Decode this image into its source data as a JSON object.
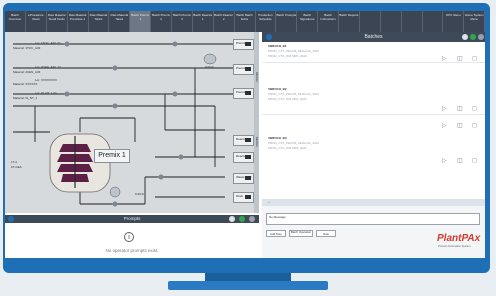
{
  "nav": {
    "buttons": [
      "Batch Overview",
      "eProcedure Views",
      "Raw Material Small Tanks",
      "Raw Material Premixes 1",
      "Raw Material Tanks",
      "Raw Material Tanks",
      "Batch Premix 1",
      "Batch Premix 2",
      "Batch Premix 3",
      "Batch Reactor 1",
      "Batch Reactor 2",
      "Batch Batch Extra",
      "Production Schedule",
      "Batch Prompts",
      "Batch Signatures",
      "Batch Instructions",
      "Batch Reports",
      "",
      "",
      "",
      "",
      "OPC Menu",
      "Home System Menu"
    ],
    "active_index": 6
  },
  "pid": {
    "tags": [
      "Material: 1TOC_A33",
      "Lot: 1TOC_A33_01",
      "Material: 2CEN_A33",
      "Lot: 2CEN_A33_12",
      "Material: XXXXXX",
      "Lot: XXXXXXXX",
      "Material: W_NT_1",
      "Lot: W_NT_1.01",
      "Premix 2",
      "Premix 3",
      "Reactor 1",
      "Reactor 2",
      "Waste Tank",
      "Drain",
      "LT-4",
      "FT-CEA",
      "0.00 lb",
      "0.00 lb"
    ],
    "vessel_label": "Premix 1",
    "side_labels": [
      "RECIRC",
      "RECIRC"
    ]
  },
  "batches": {
    "title": "Batches",
    "items": [
      {
        "name": "VBROCH_B1",
        "line1": "PROD_CTX_PECUB_MHALGS_2022",
        "line2": "PROD_CTX_WR SMS_2022"
      },
      {
        "name": "VBROCH_B2",
        "line1": "PROD_CTX_PECUB_MHALGS_2022",
        "line2": "PROD_CTX_WR SMS_2022"
      },
      {
        "name": "VBROCH_B3",
        "line1": "PROD_CTX_PECUB_MHALGS_2022",
        "line2": "PROD_CTX_WR SMS_2022"
      }
    ],
    "icons": [
      "play-icon",
      "pause-icon",
      "stop-icon"
    ]
  },
  "messages": {
    "input_placeholder": "No Message",
    "buttons": [
      "Add Note",
      "Batch Operation",
      "Note"
    ]
  },
  "brand": {
    "name": "PlantPAx",
    "tagline": "Process Automation System"
  },
  "prompts": {
    "title": "Prompts",
    "message": "No operator prompts exist."
  },
  "colors": {
    "accent": "#1e6fb6",
    "brand_red": "#d23b2d",
    "header": "#3f4a58"
  }
}
